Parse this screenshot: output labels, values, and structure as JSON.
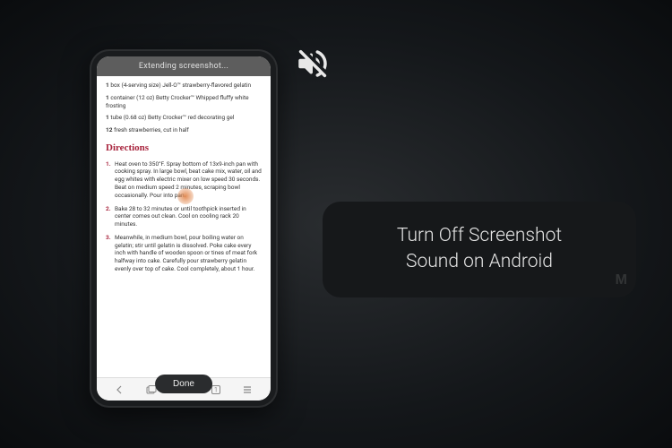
{
  "phone": {
    "header_text": "Extending screenshot...",
    "ingredients": [
      {
        "qty": "1",
        "text": "box (4-serving size) Jell-O™ strawberry-flavored gelatin"
      },
      {
        "qty": "1",
        "text": "container (12 oz) Betty Crocker™ Whipped fluffy white frosting"
      },
      {
        "qty": "1",
        "text": "tube (0.68 oz) Betty Crocker™ red decorating gel"
      },
      {
        "qty": "12",
        "text": "fresh strawberries, cut in half"
      }
    ],
    "directions_header": "Directions",
    "steps": [
      "Heat oven to 350°F. Spray bottom of 13x9-inch pan with cooking spray. In large bowl, beat cake mix, water, oil and egg whites with electric mixer on low speed 30 seconds. Beat on medium speed 2 minutes, scraping bowl occasionally. Pour into pan.",
      "Bake 28 to 32 minutes or until toothpick inserted in center comes out clean. Cool on cooling rack 20 minutes.",
      "Meanwhile, in medium bowl, pour boiling water on gelatin; stir until gelatin is dissolved. Poke cake every inch with handle of wooden spoon or tines of meat fork halfway into cake. Carefully pour strawberry gelatin evenly over top of cake. Cool completely, about 1 hour."
    ],
    "nav_tabs_label": "1",
    "done_label": "Done"
  },
  "caption": {
    "line1": "Turn Off Screenshot",
    "line2": "Sound on Android"
  },
  "watermark": "M"
}
